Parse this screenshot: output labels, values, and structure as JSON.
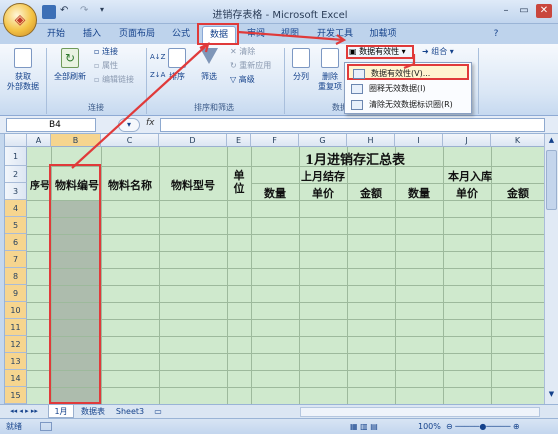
{
  "window": {
    "title": "进销存表格 - Microsoft Excel",
    "minimize": "–",
    "restore": "▭",
    "close": "✕"
  },
  "tabs": [
    {
      "label": "开始"
    },
    {
      "label": "插入"
    },
    {
      "label": "页面布局"
    },
    {
      "label": "公式"
    },
    {
      "label": "数据",
      "active": true
    },
    {
      "label": "审阅"
    },
    {
      "label": "视图"
    },
    {
      "label": "开发工具"
    },
    {
      "label": "加载项"
    }
  ],
  "ribbon": {
    "get_external": "获取\n外部数据",
    "refresh_all": "全部刷新",
    "connections": "连接",
    "properties": "属性",
    "edit_links": "编辑链接",
    "group_connections": "连接",
    "sort_az": "A↓Z",
    "sort_za": "Z↓A",
    "sort": "排序",
    "filter": "筛选",
    "clear": "清除",
    "reapply": "重新应用",
    "advanced": "高级",
    "group_sort": "排序和筛选",
    "text_to_columns": "分列",
    "remove_dup": "删除\n重复项",
    "group_tools": "数据",
    "data_validation": "数据有效性",
    "group_outline_btn": "组合"
  },
  "dv_menu": {
    "items": [
      "数据有效性(V)...",
      "圈释无效数据(I)",
      "清除无效数据标识圈(R)"
    ]
  },
  "formula_bar": {
    "name_box": "B4",
    "fx": "fx",
    "value": ""
  },
  "sheet": {
    "columns": [
      "A",
      "B",
      "C",
      "D",
      "E",
      "F",
      "G",
      "H",
      "I",
      "J",
      "K"
    ],
    "rows": [
      "1",
      "2",
      "3",
      "4",
      "5",
      "6",
      "7",
      "8",
      "9",
      "10",
      "11",
      "12",
      "13",
      "14",
      "15"
    ],
    "title": "1月进销存汇总表",
    "headers": {
      "seq": "序号",
      "code": "物料编号",
      "name": "物料名称",
      "model": "物料型号",
      "unit": "单\n位",
      "last_month": "上月结存",
      "in_month": "本月入库",
      "qty1": "数量",
      "price1": "单价",
      "amount1": "金额",
      "qty2": "数量",
      "price2": "单价",
      "amount2": "金额"
    }
  },
  "sheet_tabs": [
    "1月",
    "数据表",
    "Sheet3"
  ],
  "status": {
    "ready": "就绪",
    "zoom": "100%"
  },
  "colors": {
    "grid_bg": "#cfe9cd",
    "highlight": "#e03a3a"
  }
}
